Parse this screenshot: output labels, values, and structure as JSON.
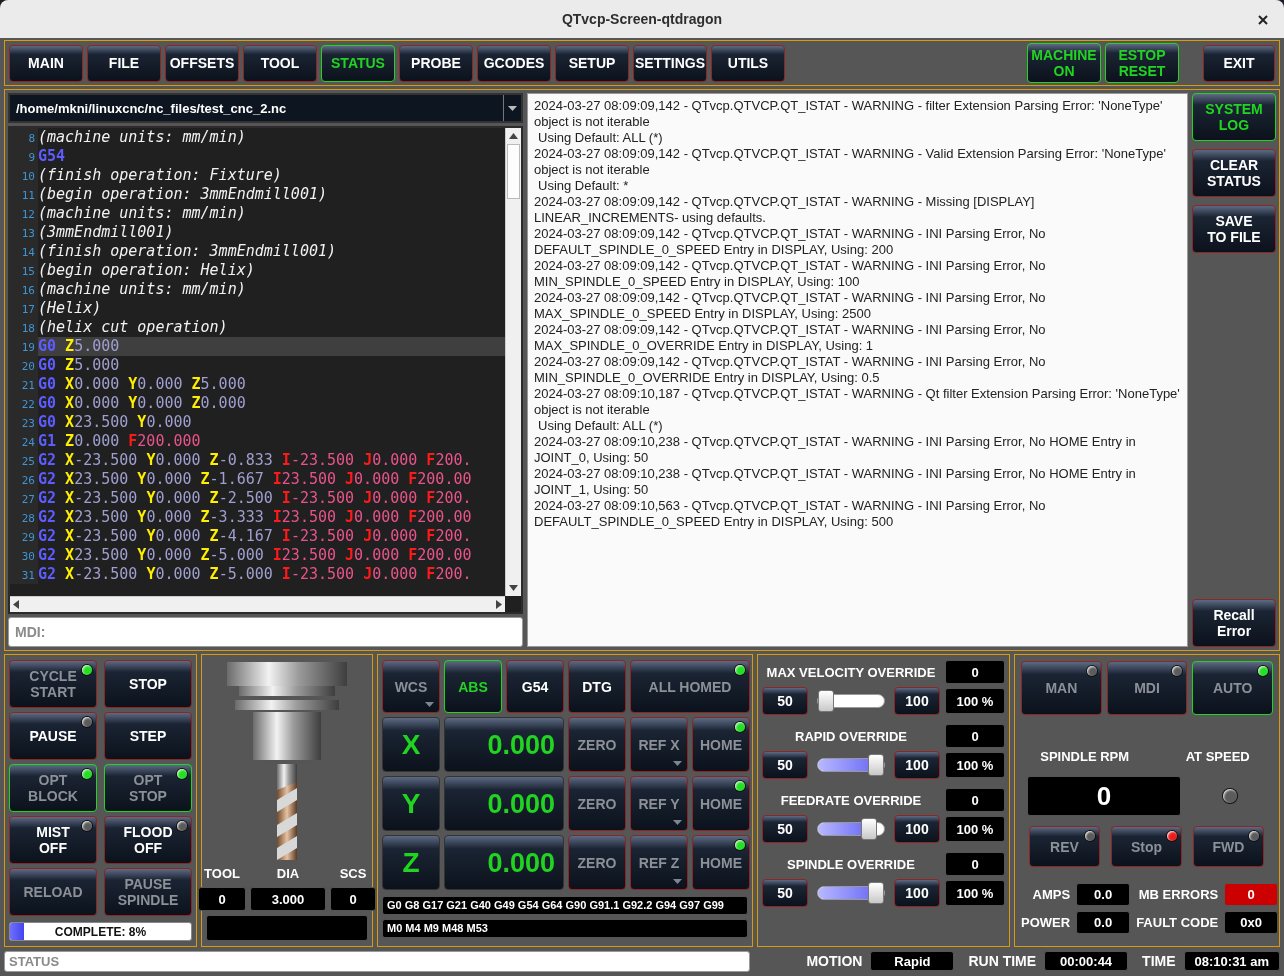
{
  "window": {
    "title": "QTvcp-Screen-qtdragon"
  },
  "tabs": [
    {
      "label": "MAIN",
      "selected": false
    },
    {
      "label": "FILE",
      "selected": false
    },
    {
      "label": "OFFSETS",
      "selected": false
    },
    {
      "label": "TOOL",
      "selected": false
    },
    {
      "label": "STATUS",
      "selected": true
    },
    {
      "label": "PROBE",
      "selected": false
    },
    {
      "label": "GCODES",
      "selected": false
    },
    {
      "label": "SETUP",
      "selected": false
    },
    {
      "label": "SETTINGS",
      "selected": false
    },
    {
      "label": "UTILS",
      "selected": false
    }
  ],
  "machine_buttons": [
    {
      "label": "MACHINE\nON",
      "on": true
    },
    {
      "label": "ESTOP\nRESET",
      "on": true
    }
  ],
  "exit_button": {
    "label": "EXIT"
  },
  "program": {
    "file": "/home/mkni/linuxcnc/nc_files/test_cnc_2.nc",
    "lines": [
      {
        "number": "8",
        "selected": false,
        "comment": "(machine units: mm/min)"
      },
      {
        "number": "9",
        "selected": false,
        "code": "G54"
      },
      {
        "number": "10",
        "selected": false,
        "comment": "(finish operation: Fixture)"
      },
      {
        "number": "11",
        "selected": false,
        "comment": "(begin operation: 3mmEndmill001)"
      },
      {
        "number": "12",
        "selected": false,
        "comment": "(machine units: mm/min)"
      },
      {
        "number": "13",
        "selected": false,
        "comment": "(3mmEndmill001)"
      },
      {
        "number": "14",
        "selected": false,
        "comment": "(finish operation: 3mmEndmill001)"
      },
      {
        "number": "15",
        "selected": false,
        "comment": "(begin operation: Helix)"
      },
      {
        "number": "16",
        "selected": false,
        "comment": "(machine units: mm/min)"
      },
      {
        "number": "17",
        "selected": false,
        "comment": "(Helix)"
      },
      {
        "number": "18",
        "selected": false,
        "comment": "(helix cut operation)"
      },
      {
        "number": "19",
        "selected": true,
        "code": "G0",
        "words": [
          {
            "kind": "axis",
            "letter": "Z",
            "value": "5.000"
          }
        ]
      },
      {
        "number": "20",
        "selected": false,
        "code": "G0",
        "words": [
          {
            "kind": "axis",
            "letter": "Z",
            "value": "5.000"
          }
        ]
      },
      {
        "number": "21",
        "selected": false,
        "code": "G0",
        "words": [
          {
            "kind": "axis",
            "letter": "X",
            "value": "0.000"
          },
          {
            "kind": "axis",
            "letter": "Y",
            "value": "0.000"
          },
          {
            "kind": "axis",
            "letter": "Z",
            "value": "5.000"
          }
        ]
      },
      {
        "number": "22",
        "selected": false,
        "code": "G0",
        "words": [
          {
            "kind": "axis",
            "letter": "X",
            "value": "0.000"
          },
          {
            "kind": "axis",
            "letter": "Y",
            "value": "0.000"
          },
          {
            "kind": "axis",
            "letter": "Z",
            "value": "0.000"
          }
        ]
      },
      {
        "number": "23",
        "selected": false,
        "code": "G0",
        "words": [
          {
            "kind": "axis",
            "letter": "X",
            "value": "23.500"
          },
          {
            "kind": "axis",
            "letter": "Y",
            "value": "0.000"
          }
        ]
      },
      {
        "number": "24",
        "selected": false,
        "code": "G1",
        "words": [
          {
            "kind": "axis",
            "letter": "Z",
            "value": "0.000"
          },
          {
            "kind": "param",
            "letter": "F",
            "value": "200.000"
          }
        ]
      },
      {
        "number": "25",
        "selected": false,
        "code": "G2",
        "words": [
          {
            "kind": "axis",
            "letter": "X",
            "value": "-23.500"
          },
          {
            "kind": "axis",
            "letter": "Y",
            "value": "0.000"
          },
          {
            "kind": "axis",
            "letter": "Z",
            "value": "-0.833"
          },
          {
            "kind": "param",
            "letter": "I",
            "value": "-23.500"
          },
          {
            "kind": "param",
            "letter": "J",
            "value": "0.000"
          },
          {
            "kind": "param",
            "letter": "F",
            "value": "200."
          }
        ]
      },
      {
        "number": "26",
        "selected": false,
        "code": "G2",
        "words": [
          {
            "kind": "axis",
            "letter": "X",
            "value": "23.500"
          },
          {
            "kind": "axis",
            "letter": "Y",
            "value": "0.000"
          },
          {
            "kind": "axis",
            "letter": "Z",
            "value": "-1.667"
          },
          {
            "kind": "param",
            "letter": "I",
            "value": "23.500"
          },
          {
            "kind": "param",
            "letter": "J",
            "value": "0.000"
          },
          {
            "kind": "param",
            "letter": "F",
            "value": "200.00"
          }
        ]
      },
      {
        "number": "27",
        "selected": false,
        "code": "G2",
        "words": [
          {
            "kind": "axis",
            "letter": "X",
            "value": "-23.500"
          },
          {
            "kind": "axis",
            "letter": "Y",
            "value": "0.000"
          },
          {
            "kind": "axis",
            "letter": "Z",
            "value": "-2.500"
          },
          {
            "kind": "param",
            "letter": "I",
            "value": "-23.500"
          },
          {
            "kind": "param",
            "letter": "J",
            "value": "0.000"
          },
          {
            "kind": "param",
            "letter": "F",
            "value": "200."
          }
        ]
      },
      {
        "number": "28",
        "selected": false,
        "code": "G2",
        "words": [
          {
            "kind": "axis",
            "letter": "X",
            "value": "23.500"
          },
          {
            "kind": "axis",
            "letter": "Y",
            "value": "0.000"
          },
          {
            "kind": "axis",
            "letter": "Z",
            "value": "-3.333"
          },
          {
            "kind": "param",
            "letter": "I",
            "value": "23.500"
          },
          {
            "kind": "param",
            "letter": "J",
            "value": "0.000"
          },
          {
            "kind": "param",
            "letter": "F",
            "value": "200.00"
          }
        ]
      },
      {
        "number": "29",
        "selected": false,
        "code": "G2",
        "words": [
          {
            "kind": "axis",
            "letter": "X",
            "value": "-23.500"
          },
          {
            "kind": "axis",
            "letter": "Y",
            "value": "0.000"
          },
          {
            "kind": "axis",
            "letter": "Z",
            "value": "-4.167"
          },
          {
            "kind": "param",
            "letter": "I",
            "value": "-23.500"
          },
          {
            "kind": "param",
            "letter": "J",
            "value": "0.000"
          },
          {
            "kind": "param",
            "letter": "F",
            "value": "200."
          }
        ]
      },
      {
        "number": "30",
        "selected": false,
        "code": "G2",
        "words": [
          {
            "kind": "axis",
            "letter": "X",
            "value": "23.500"
          },
          {
            "kind": "axis",
            "letter": "Y",
            "value": "0.000"
          },
          {
            "kind": "axis",
            "letter": "Z",
            "value": "-5.000"
          },
          {
            "kind": "param",
            "letter": "I",
            "value": "23.500"
          },
          {
            "kind": "param",
            "letter": "J",
            "value": "0.000"
          },
          {
            "kind": "param",
            "letter": "F",
            "value": "200.00"
          }
        ]
      },
      {
        "number": "31",
        "selected": false,
        "code": "G2",
        "words": [
          {
            "kind": "axis",
            "letter": "X",
            "value": "-23.500"
          },
          {
            "kind": "axis",
            "letter": "Y",
            "value": "0.000"
          },
          {
            "kind": "axis",
            "letter": "Z",
            "value": "-5.000"
          },
          {
            "kind": "param",
            "letter": "I",
            "value": "-23.500"
          },
          {
            "kind": "param",
            "letter": "J",
            "value": "0.000"
          },
          {
            "kind": "param",
            "letter": "F",
            "value": "200."
          }
        ]
      }
    ]
  },
  "mdi": {
    "placeholder": "MDI:"
  },
  "log": {
    "entries": [
      {
        "kind": "message",
        "text": "2024-03-27 08:09:09,142 - QTvcp.QTVCP.QT_ISTAT - WARNING - filter Extension Parsing Error: 'NoneType' object is not iterable"
      },
      {
        "kind": "detail",
        "text": "Using Default: ALL (*)"
      },
      {
        "kind": "message",
        "text": "2024-03-27 08:09:09,142 - QTvcp.QTVCP.QT_ISTAT - WARNING - Valid Extension Parsing Error: 'NoneType' object is not iterable"
      },
      {
        "kind": "detail",
        "text": "Using Default: *"
      },
      {
        "kind": "message",
        "text": "2024-03-27 08:09:09,142 - QTvcp.QTVCP.QT_ISTAT - WARNING - Missing [DISPLAY] LINEAR_INCREMENTS- using defaults."
      },
      {
        "kind": "message",
        "text": "2024-03-27 08:09:09,142 - QTvcp.QTVCP.QT_ISTAT - WARNING - INI Parsing Error, No DEFAULT_SPINDLE_0_SPEED Entry in DISPLAY, Using: 200"
      },
      {
        "kind": "message",
        "text": "2024-03-27 08:09:09,142 - QTvcp.QTVCP.QT_ISTAT - WARNING - INI Parsing Error, No MIN_SPINDLE_0_SPEED Entry in DISPLAY, Using: 100"
      },
      {
        "kind": "message",
        "text": "2024-03-27 08:09:09,142 - QTvcp.QTVCP.QT_ISTAT - WARNING - INI Parsing Error, No MAX_SPINDLE_0_SPEED Entry in DISPLAY, Using: 2500"
      },
      {
        "kind": "message",
        "text": "2024-03-27 08:09:09,142 - QTvcp.QTVCP.QT_ISTAT - WARNING - INI Parsing Error, No MAX_SPINDLE_0_OVERRIDE Entry in DISPLAY, Using: 1"
      },
      {
        "kind": "message",
        "text": "2024-03-27 08:09:09,142 - QTvcp.QTVCP.QT_ISTAT - WARNING - INI Parsing Error, No MIN_SPINDLE_0_OVERRIDE Entry in DISPLAY, Using: 0.5"
      },
      {
        "kind": "message",
        "text": "2024-03-27 08:09:10,187 - QTvcp.QTVCP.QT_ISTAT - WARNING - Qt filter Extension Parsing Error: 'NoneType' object is not iterable"
      },
      {
        "kind": "detail",
        "text": "Using Default: ALL (*)"
      },
      {
        "kind": "message",
        "text": "2024-03-27 08:09:10,238 - QTvcp.QTVCP.QT_ISTAT - WARNING - INI Parsing Error, No HOME Entry in JOINT_0, Using: 50"
      },
      {
        "kind": "message",
        "text": "2024-03-27 08:09:10,238 - QTvcp.QTVCP.QT_ISTAT - WARNING - INI Parsing Error, No HOME Entry in JOINT_1, Using: 50"
      },
      {
        "kind": "message",
        "text": "2024-03-27 08:09:10,563 - QTvcp.QTVCP.QT_ISTAT - WARNING - INI Parsing Error, No DEFAULT_SPINDLE_0_SPEED Entry in DISPLAY, Using: 500"
      }
    ]
  },
  "log_buttons": [
    {
      "label": "SYSTEM\nLOG",
      "selected": true
    },
    {
      "label": "CLEAR\nSTATUS",
      "selected": false
    },
    {
      "label": "SAVE\nTO FILE",
      "selected": false
    },
    {
      "label": "Recall\nError",
      "selected": false
    }
  ],
  "controls": {
    "buttons": [
      {
        "label": "CYCLE\nSTART",
        "disabled": true,
        "active": false,
        "led": {
          "lit": true,
          "color": "#22e022"
        }
      },
      {
        "label": "STOP",
        "disabled": false,
        "active": false
      },
      {
        "label": "PAUSE",
        "disabled": false,
        "active": false,
        "led": {
          "lit": false
        }
      },
      {
        "label": "STEP",
        "disabled": false,
        "active": false
      },
      {
        "label": "OPT\nBLOCK",
        "disabled": true,
        "active": true,
        "led": {
          "lit": true,
          "color": "#22e022"
        }
      },
      {
        "label": "OPT\nSTOP",
        "disabled": true,
        "active": true,
        "led": {
          "lit": true,
          "color": "#22e022"
        }
      },
      {
        "label": "MIST\nOFF",
        "disabled": false,
        "active": false,
        "led": {
          "lit": false
        }
      },
      {
        "label": "FLOOD\nOFF",
        "disabled": false,
        "active": false,
        "led": {
          "lit": false
        }
      },
      {
        "label": "RELOAD",
        "disabled": true,
        "active": false
      },
      {
        "label": "PAUSE\nSPINDLE",
        "disabled": true,
        "active": false
      }
    ],
    "progress": {
      "label": "COMPLETE: 8%",
      "level": 0.08
    }
  },
  "tool": {
    "fields": [
      {
        "label": "TOOL",
        "value": "0"
      },
      {
        "label": "DIA",
        "value": "3.000"
      },
      {
        "label": "SCS",
        "value": "0"
      }
    ]
  },
  "dro": {
    "modes": [
      {
        "label": "WCS",
        "disabled": true,
        "selected": false,
        "dropdown": true
      },
      {
        "label": "ABS",
        "disabled": false,
        "selected": true
      },
      {
        "label": "G54",
        "disabled": false,
        "selected": false
      },
      {
        "label": "DTG",
        "disabled": false,
        "selected": false
      },
      {
        "label": "ALL HOMED",
        "disabled": true,
        "selected": false,
        "led": {
          "lit": true,
          "color": "#22e022"
        }
      }
    ],
    "axes": [
      {
        "axis": "X",
        "value": "0.000",
        "buttons": [
          {
            "label": "ZERO",
            "disabled": true
          },
          {
            "label": "REF X",
            "disabled": true,
            "dropdown": true
          },
          {
            "label": "HOME",
            "disabled": true,
            "led": {
              "lit": true,
              "color": "#22e022"
            }
          }
        ]
      },
      {
        "axis": "Y",
        "value": "0.000",
        "buttons": [
          {
            "label": "ZERO",
            "disabled": true
          },
          {
            "label": "REF Y",
            "disabled": true,
            "dropdown": true
          },
          {
            "label": "HOME",
            "disabled": true,
            "led": {
              "lit": true,
              "color": "#22e022"
            }
          }
        ]
      },
      {
        "axis": "Z",
        "value": "0.000",
        "buttons": [
          {
            "label": "ZERO",
            "disabled": true
          },
          {
            "label": "REF Z",
            "disabled": true,
            "dropdown": true
          },
          {
            "label": "HOME",
            "disabled": true,
            "led": {
              "lit": true,
              "color": "#22e022"
            }
          }
        ]
      }
    ],
    "gcodes": "G0 G8 G17 G21 G40 G49 G54 G64 G90 G91.1 G92.2 G94 G97 G99",
    "mcodes": "M0 M4 M9 M48 M53"
  },
  "overrides": [
    {
      "title": "MAX VELOCITY OVERRIDE",
      "value": "0",
      "min": "50",
      "max": "100",
      "percent": "100 %",
      "level": 0
    },
    {
      "title": "RAPID OVERRIDE",
      "value": "0",
      "min": "50",
      "max": "100",
      "percent": "100 %",
      "level": 1
    },
    {
      "title": "FEEDRATE OVERRIDE",
      "value": "0",
      "min": "50",
      "max": "100",
      "percent": "100 %",
      "level": 0.85
    },
    {
      "title": "SPINDLE OVERRIDE",
      "value": "0",
      "min": "50",
      "max": "100",
      "percent": "100 %",
      "level": 1
    }
  ],
  "spindle": {
    "modes": [
      {
        "label": "MAN",
        "selected": false,
        "led": {
          "lit": false
        }
      },
      {
        "label": "MDI",
        "selected": false,
        "led": {
          "lit": false
        }
      },
      {
        "label": "AUTO",
        "selected": true,
        "led": {
          "lit": true,
          "color": "#22e022"
        }
      }
    ],
    "rpm_label": "SPINDLE RPM",
    "at_speed_label": "AT SPEED",
    "rpm": "0",
    "at_speed": false,
    "directions": [
      {
        "label": "REV",
        "led": {
          "lit": false
        }
      },
      {
        "label": "Stop",
        "led": {
          "lit": true,
          "color": "#f01c1c"
        }
      },
      {
        "label": "FWD",
        "led": {
          "lit": false
        }
      }
    ],
    "readouts": [
      {
        "label": "AMPS",
        "value": "0.0",
        "alarm": false
      },
      {
        "label": "MB ERRORS",
        "value": "0",
        "alarm": true
      },
      {
        "label": "POWER",
        "value": "0.0",
        "alarm": false
      },
      {
        "label": "FAULT CODE",
        "value": "0x0",
        "alarm": false
      }
    ]
  },
  "status_bar": {
    "placeholder": "STATUS",
    "items": [
      {
        "label": "MOTION",
        "value": "Rapid"
      },
      {
        "label": "RUN TIME",
        "value": "00:00:44"
      },
      {
        "label": "TIME",
        "value": "08:10:31 am"
      }
    ]
  }
}
